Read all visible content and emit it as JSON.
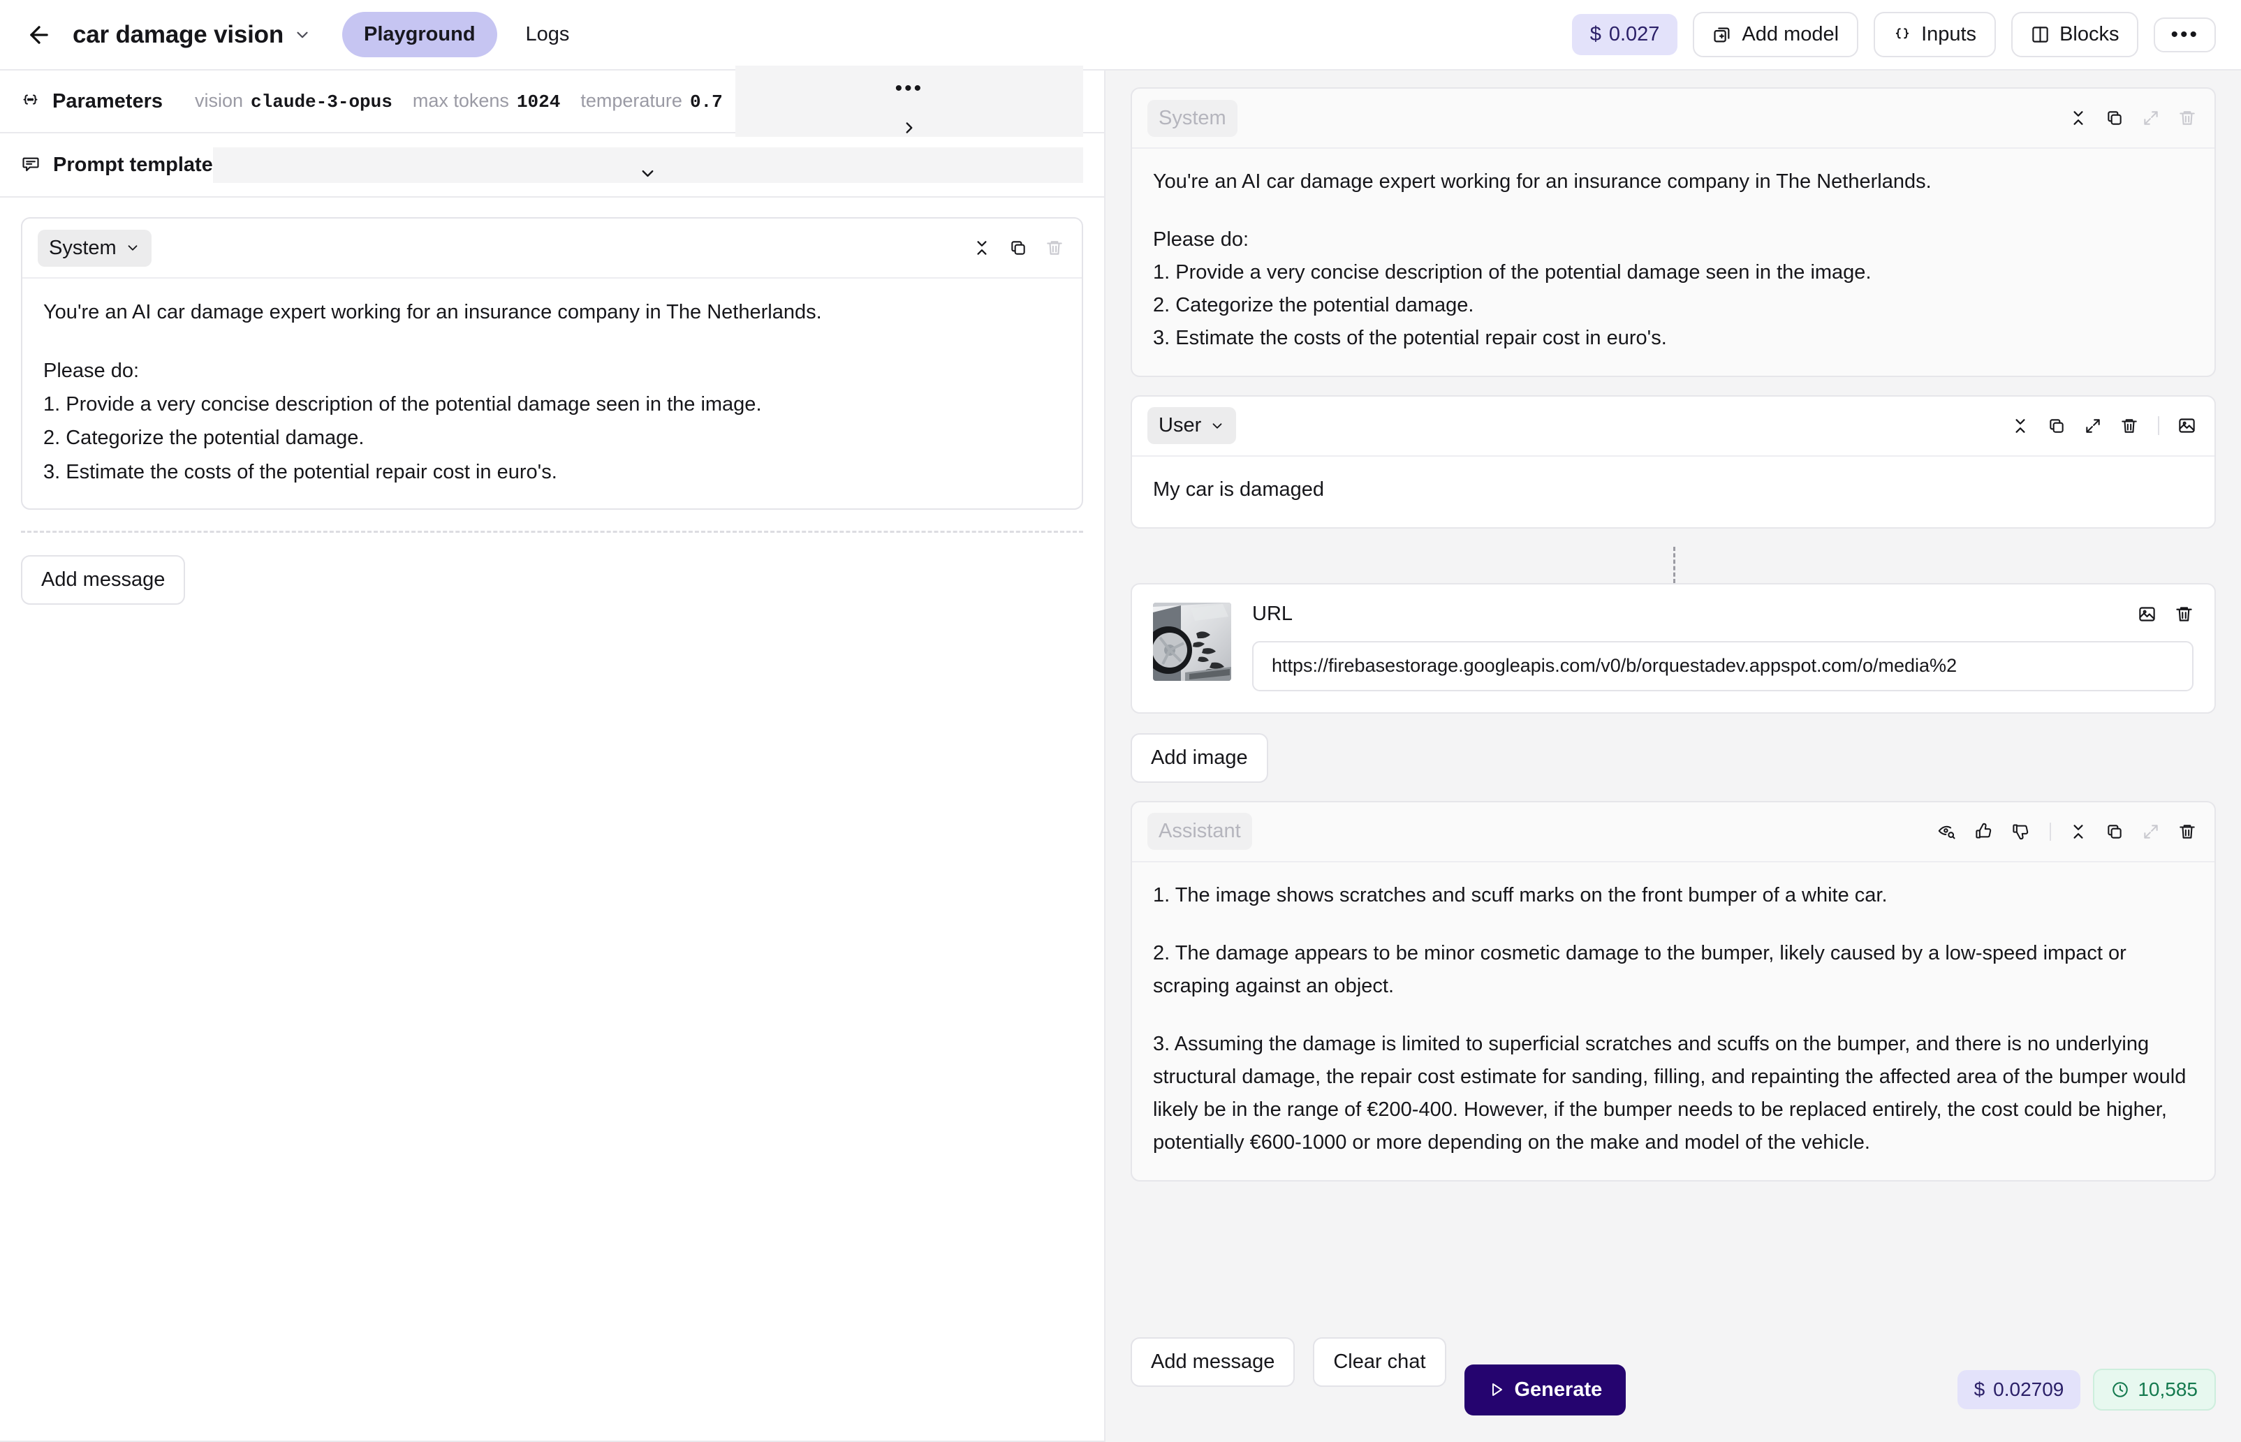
{
  "topbar": {
    "back_icon": "arrow-left-icon",
    "project_title": "car damage vision",
    "title_chevron": "chevron-down-icon",
    "tabs": [
      {
        "label": "Playground",
        "active": true
      },
      {
        "label": "Logs",
        "active": false
      }
    ],
    "cost_pill": {
      "currency": "$",
      "value": "0.027"
    },
    "buttons": [
      {
        "label": "Add model",
        "icon": "add-model-icon"
      },
      {
        "label": "Inputs",
        "icon": "braces-icon"
      },
      {
        "label": "Blocks",
        "icon": "blocks-icon"
      }
    ],
    "more_label": "•••"
  },
  "left": {
    "parameters": {
      "label": "Parameters",
      "icon": "braces-dots-icon",
      "meta": [
        {
          "key": "vision",
          "value": "claude-3-opus"
        },
        {
          "key": "max tokens",
          "value": "1024"
        },
        {
          "key": "temperature",
          "value": "0.7"
        }
      ],
      "more_label": "•••",
      "expand_icon": "chevron-right-icon"
    },
    "prompt_template": {
      "label": "Prompt template",
      "icon": "template-icon",
      "collapse_icon": "chevron-down-icon"
    },
    "system_message": {
      "role": "System",
      "role_chevron": "chevron-down-icon",
      "icons": [
        "collapse-icon",
        "copy-icon",
        "trash-icon"
      ],
      "paragraphs": [
        "You're an AI car damage expert working for an insurance company in The Netherlands.",
        "Please do:",
        "1. Provide a very concise description of the potential damage seen in the image.",
        "2. Categorize the potential damage.",
        "3. Estimate the costs of the potential repair cost in euro's."
      ]
    },
    "add_message_label": "Add message"
  },
  "right": {
    "system_message": {
      "role": "System",
      "icons": [
        "collapse-icon",
        "copy-icon",
        "expand-icon",
        "trash-icon"
      ],
      "paragraphs": [
        "You're an AI car damage expert working for an insurance company in The Netherlands.",
        "Please do:",
        "1. Provide a very concise description of the potential damage seen in the image.",
        "2. Categorize the potential damage.",
        "3. Estimate the costs of the potential repair cost in euro's."
      ]
    },
    "user_message": {
      "role": "User",
      "role_chevron": "chevron-down-icon",
      "icons": [
        "collapse-icon",
        "copy-icon",
        "expand-icon",
        "trash-icon",
        "image-icon"
      ],
      "text": "My car is damaged"
    },
    "image_block": {
      "thumbnail_alt": "damaged-white-car-front-bumper",
      "url_label": "URL",
      "icons": [
        "image-icon",
        "trash-icon"
      ],
      "url_value": "https://firebasestorage.googleapis.com/v0/b/orquestadev.appspot.com/o/media%2",
      "add_image_label": "Add image"
    },
    "assistant_message": {
      "role": "Assistant",
      "icons": [
        "eye-search-icon",
        "thumbs-up-icon",
        "thumbs-down-icon",
        "collapse-icon",
        "copy-icon",
        "expand-icon",
        "trash-icon"
      ],
      "paragraphs": [
        "1. The image shows scratches and scuff marks on the front bumper of a white car.",
        "2. The damage appears to be minor cosmetic damage to the bumper, likely caused by a low-speed impact or scraping against an object.",
        "3. Assuming the damage is limited to superficial scratches and scuffs on the bumper, and there is no underlying structural damage, the repair cost estimate for sanding, filling, and repainting the affected area of the bumper would likely be in the range of €200-400. However, if the bumper needs to be replaced entirely, the cost could be higher, potentially €600-1000 or more depending on the make and model of the vehicle."
      ]
    },
    "bottom_bar": {
      "add_message_label": "Add message",
      "clear_chat_label": "Clear chat",
      "generate_label": "Generate",
      "generate_icon": "play-icon",
      "cost_pill": {
        "currency": "$",
        "value": "0.02709"
      },
      "tokens_pill": {
        "icon": "clock-icon",
        "value": "10,585"
      }
    }
  },
  "colors": {
    "accent_purple": "#25046f",
    "tab_active_bg": "#c6c5f2",
    "cost_pill_bg": "#e3e2fa",
    "tokens_pill_bg": "#e7f8ef",
    "tokens_pill_fg": "#14794e",
    "panel_bg": "#f4f4f5",
    "border": "#e6e6ea"
  }
}
